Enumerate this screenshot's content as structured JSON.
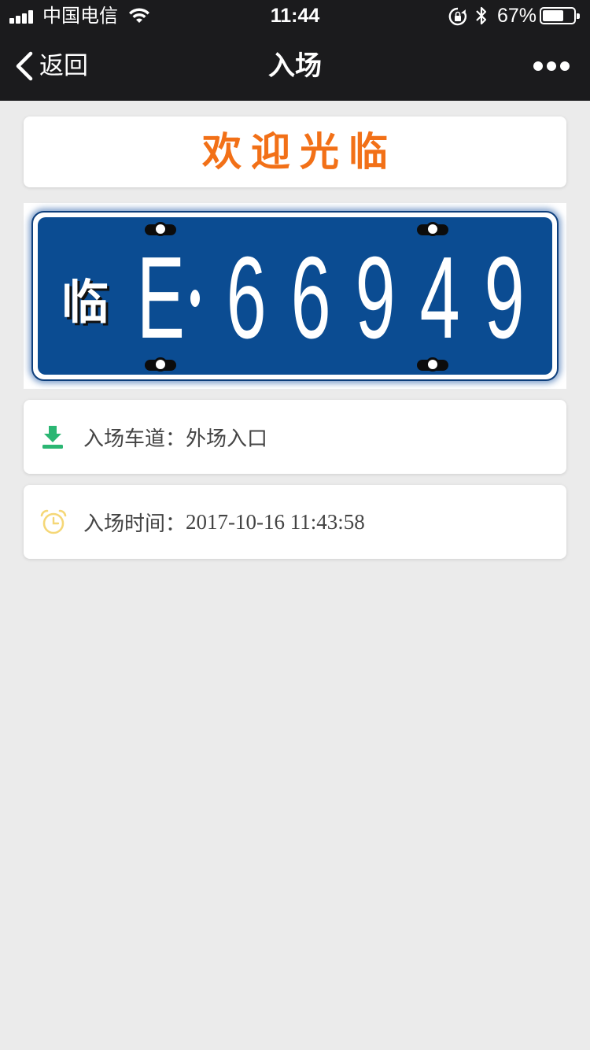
{
  "status_bar": {
    "carrier": "中国电信",
    "time": "11:44",
    "battery_percent_text": "67%",
    "battery_level": 0.67,
    "icons": [
      "signal-icon",
      "wifi-icon",
      "rotation-lock-icon",
      "bluetooth-icon",
      "battery-icon"
    ]
  },
  "nav": {
    "back_label": "返回",
    "title": "入场",
    "more_icon": "more-dots-icon"
  },
  "welcome": {
    "text": "欢迎光临",
    "color": "#f27017"
  },
  "plate": {
    "prefix": "临",
    "letter": "E",
    "digits": [
      "6",
      "6",
      "9",
      "4",
      "9"
    ],
    "plate_color": "#0b4c92"
  },
  "info": {
    "lane_label": "入场车道：",
    "lane_value": "外场入口",
    "lane_icon": "download-icon",
    "lane_icon_color": "#2bb673",
    "time_label": "入场时间：",
    "time_value": "2017-10-16 11:43:58",
    "time_icon": "alarm-clock-icon",
    "time_icon_color": "#f5d777"
  }
}
